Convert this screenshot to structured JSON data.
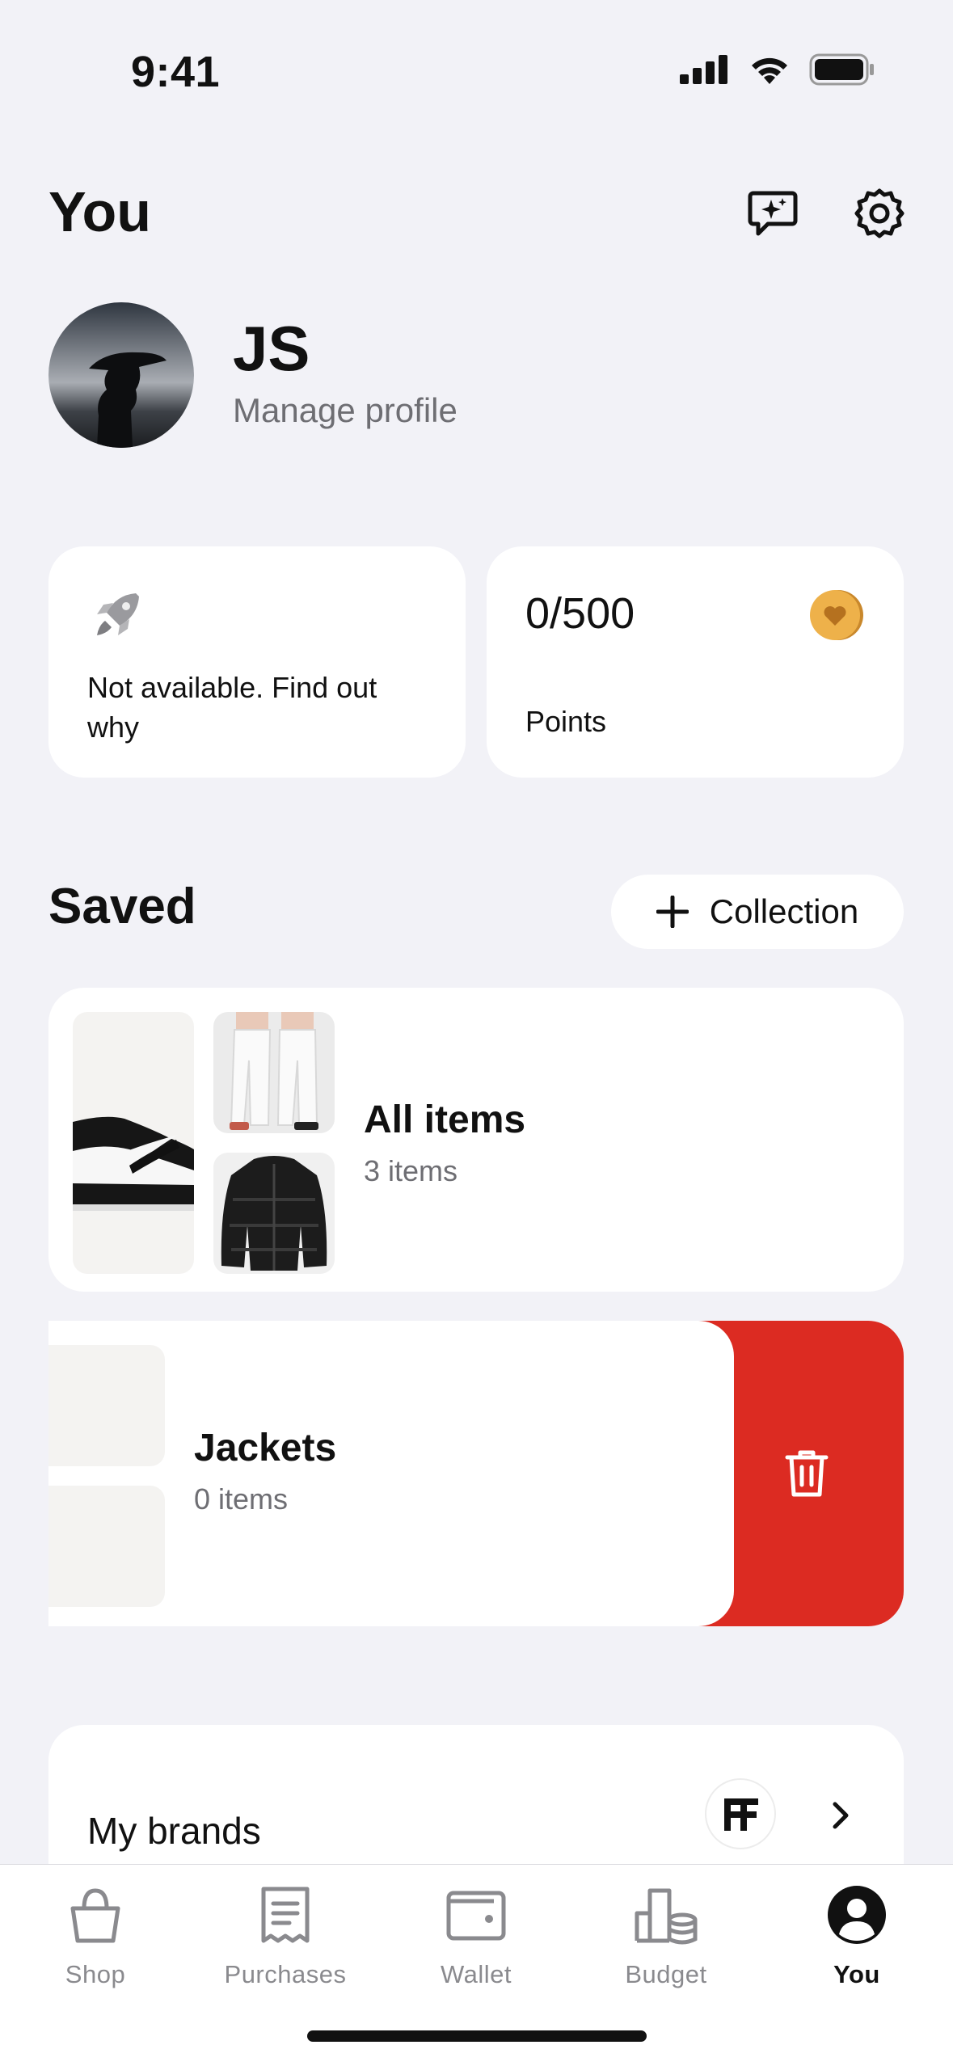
{
  "status_bar": {
    "time": "9:41"
  },
  "header": {
    "title": "You",
    "icons": [
      "chat-sparkle-icon",
      "gear-icon"
    ]
  },
  "profile": {
    "initials": "JS",
    "manage_label": "Manage profile"
  },
  "promo_card": {
    "text": "Not available. Find out why",
    "icon": "rocket-icon"
  },
  "points_card": {
    "value": "0/500",
    "label": "Points",
    "icon": "heart-coin-icon"
  },
  "saved": {
    "title": "Saved",
    "add_button_label": "Collection",
    "collections": [
      {
        "name": "All items",
        "count": "3 items"
      },
      {
        "name": "Jackets",
        "count": "0 items"
      }
    ],
    "delete_icon": "trash-icon"
  },
  "brands": {
    "title": "My brands",
    "brand_logo": "FF"
  },
  "tabs": [
    {
      "label": "Shop",
      "icon": "bag-icon"
    },
    {
      "label": "Purchases",
      "icon": "receipt-icon"
    },
    {
      "label": "Wallet",
      "icon": "wallet-icon"
    },
    {
      "label": "Budget",
      "icon": "budget-icon"
    },
    {
      "label": "You",
      "icon": "person-icon",
      "active": true
    }
  ],
  "colors": {
    "accent_red": "#dc2b22",
    "background": "#f2f2f7",
    "coin": "#e8a640"
  }
}
